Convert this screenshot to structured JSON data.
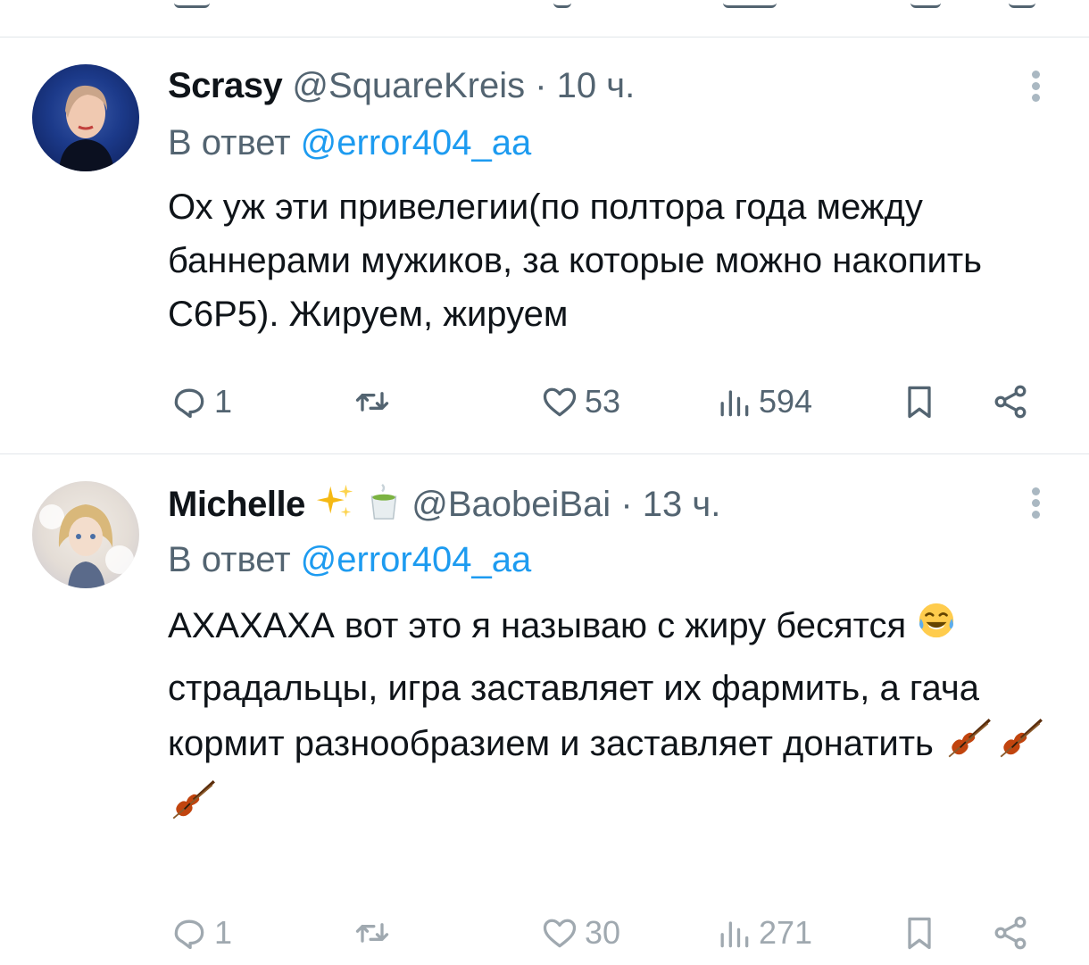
{
  "tweets": [
    {
      "name": "Scrasy",
      "handle": "@SquareKreis",
      "separator": "·",
      "time": "10 ч.",
      "reply_prefix": "В ответ",
      "reply_to": "@error404_aa",
      "text_lines": [
        "Ох уж эти привелегии(по полтора года между баннерами мужиков, за которые можно накопить С6Р5). Жируем, жируем"
      ],
      "stats": {
        "replies": "1",
        "likes": "53",
        "views": "594"
      }
    },
    {
      "name": "Michelle",
      "name_emojis": [
        "sparkles-emoji",
        "matcha-cup-emoji"
      ],
      "handle": "@BaobeiBai",
      "separator": "·",
      "time": "13 ч.",
      "reply_prefix": "В ответ",
      "reply_to": "@error404_aa",
      "text_line_1": "АХАХАХА вот это я называю с жиру бесятся",
      "text_line_2": "страдальцы, игра заставляет их фармить, а гача кормит разнообразием и заставляет донатить",
      "inline_emojis": [
        "tears-of-joy-emoji",
        "violin-emoji",
        "violin-emoji",
        "violin-emoji"
      ],
      "stats": {
        "replies": "1",
        "likes": "30",
        "views": "271"
      }
    }
  ],
  "colors": {
    "text": "#0f1419",
    "secondary": "#536471",
    "link": "#1d9bf0",
    "divider": "#e1e6ea"
  },
  "icons": [
    "reply-icon",
    "retweet-icon",
    "like-icon",
    "views-icon",
    "bookmark-icon",
    "share-icon",
    "more-icon"
  ]
}
